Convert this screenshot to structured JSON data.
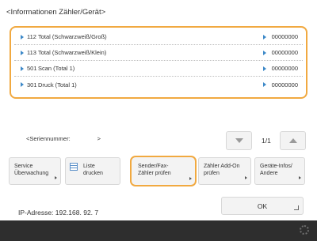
{
  "title": "<Informationen Zähler/Gerät>",
  "counters": [
    {
      "num": "112",
      "label": "Total (Schwarzweiß/Groß)",
      "value": "00000000"
    },
    {
      "num": "113",
      "label": "Total (Schwarzweiß/Klein)",
      "value": "00000000"
    },
    {
      "num": "501",
      "label": "Scan (Total 1)",
      "value": "00000000"
    },
    {
      "num": "301",
      "label": "Druck (Total 1)",
      "value": "00000000"
    }
  ],
  "serial": {
    "label": "<Seriennummer:",
    "value": ">"
  },
  "pager": {
    "indicator": "1/1"
  },
  "function_buttons": [
    {
      "line1": "Service",
      "line2": "Überwachung"
    },
    {
      "line1": "Liste",
      "line2": "drucken"
    },
    {
      "line1": "Sender/Fax-",
      "line2": "Zähler prüfen"
    },
    {
      "line1": "Zähler Add-On",
      "line2": "prüfen"
    },
    {
      "line1": "Geräte-Infos/",
      "line2": "Andere"
    }
  ],
  "ip_address": "IP-Adresse: 192.168. 92. 7",
  "ok_label": "OK",
  "colors": {
    "highlight": "#f1a940",
    "bullet": "#3c88c8",
    "bottom_bar": "#2e2e2e"
  }
}
